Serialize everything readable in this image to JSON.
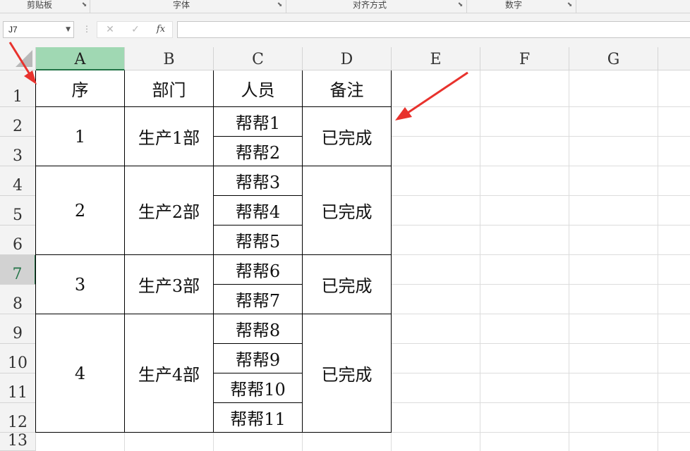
{
  "ribbon": {
    "groups": [
      {
        "label": "剪贴板"
      },
      {
        "label": "字体"
      },
      {
        "label": "对齐方式"
      },
      {
        "label": "数字"
      }
    ]
  },
  "formula_bar": {
    "name_box": "J7",
    "cancel_icon": "close-icon",
    "enter_icon": "check-icon",
    "function_label": "fx",
    "formula": ""
  },
  "sheet": {
    "columns": [
      "A",
      "B",
      "C",
      "D",
      "E",
      "F",
      "G"
    ],
    "rows": [
      "1",
      "2",
      "3",
      "4",
      "5",
      "6",
      "7",
      "8",
      "9",
      "10",
      "11",
      "12",
      "13"
    ],
    "selected_column": "A",
    "selected_row": "7",
    "header": {
      "a1": "序",
      "b1": "部门",
      "c1": "人员",
      "d1": "备注"
    },
    "groups": [
      {
        "seq": "1",
        "dept": "生产1部",
        "note": "已完成",
        "people": [
          "帮帮1",
          "帮帮2"
        ]
      },
      {
        "seq": "2",
        "dept": "生产2部",
        "note": "已完成",
        "people": [
          "帮帮3",
          "帮帮4",
          "帮帮5"
        ]
      },
      {
        "seq": "3",
        "dept": "生产3部",
        "note": "已完成",
        "people": [
          "帮帮6",
          "帮帮7"
        ]
      },
      {
        "seq": "4",
        "dept": "生产4部",
        "note": "已完成",
        "people": [
          "帮帮8",
          "帮帮9",
          "帮帮10",
          "帮帮11"
        ]
      }
    ]
  },
  "colors": {
    "accent": "#217346",
    "selected_col_header": "#a0d8b3",
    "arrow": "#e8322d"
  }
}
